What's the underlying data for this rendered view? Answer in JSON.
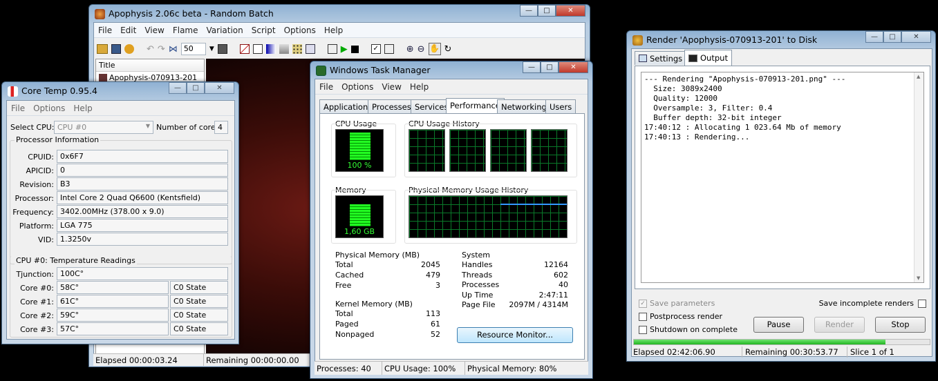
{
  "apophysis": {
    "title": "Apophysis 2.06c beta - Random Batch",
    "menu": [
      "File",
      "Edit",
      "View",
      "Flame",
      "Variation",
      "Script",
      "Options",
      "Help"
    ],
    "zoom_value": "50",
    "list_header": "Title",
    "list_item": "Apophysis-070913-201",
    "status_elapsed": "Elapsed 00:00:03.24",
    "status_remaining": "Remaining 00:00:00.00"
  },
  "coretemp": {
    "title": "Core Temp 0.95.4",
    "menu": [
      "File",
      "Options",
      "Help"
    ],
    "select_cpu_label": "Select CPU:",
    "select_cpu_value": "CPU #0",
    "num_cores_label": "Number of cores",
    "num_cores_value": "4",
    "proc_info_label": "Processor Information",
    "rows": [
      {
        "label": "CPUID:",
        "value": "0x6F7"
      },
      {
        "label": "APICID:",
        "value": "0"
      },
      {
        "label": "Revision:",
        "value": "B3"
      },
      {
        "label": "Processor:",
        "value": "Intel Core 2 Quad Q6600 (Kentsfield)"
      },
      {
        "label": "Frequency:",
        "value": "3402.00MHz (378.00 x 9.0)"
      },
      {
        "label": "Platform:",
        "value": "LGA 775"
      },
      {
        "label": "VID:",
        "value": "1.3250v"
      }
    ],
    "temp_label": "CPU #0: Temperature Readings",
    "tjunction_label": "Tjunction:",
    "tjunction_value": "100C°",
    "cores": [
      {
        "label": "Core #0:",
        "temp": "58C°",
        "state": "C0 State"
      },
      {
        "label": "Core #1:",
        "temp": "61C°",
        "state": "C0 State"
      },
      {
        "label": "Core #2:",
        "temp": "59C°",
        "state": "C0 State"
      },
      {
        "label": "Core #3:",
        "temp": "57C°",
        "state": "C0 State"
      }
    ]
  },
  "taskmgr": {
    "title": "Windows Task Manager",
    "menu": [
      "File",
      "Options",
      "View",
      "Help"
    ],
    "tabs": [
      "Applications",
      "Processes",
      "Services",
      "Performance",
      "Networking",
      "Users"
    ],
    "cpu_usage_label": "CPU Usage",
    "cpu_usage_value": "100 %",
    "cpu_history_label": "CPU Usage History",
    "memory_label": "Memory",
    "memory_value": "1,60 GB",
    "mem_history_label": "Physical Memory Usage History",
    "phys_mem_label": "Physical Memory (MB)",
    "phys_mem": [
      {
        "k": "Total",
        "v": "2045"
      },
      {
        "k": "Cached",
        "v": "479"
      },
      {
        "k": "Free",
        "v": "3"
      }
    ],
    "kernel_label": "Kernel Memory (MB)",
    "kernel": [
      {
        "k": "Total",
        "v": "113"
      },
      {
        "k": "Paged",
        "v": "61"
      },
      {
        "k": "Nonpaged",
        "v": "52"
      }
    ],
    "system_label": "System",
    "system": [
      {
        "k": "Handles",
        "v": "12164"
      },
      {
        "k": "Threads",
        "v": "602"
      },
      {
        "k": "Processes",
        "v": "40"
      },
      {
        "k": "Up Time",
        "v": "2:47:11"
      },
      {
        "k": "Page File",
        "v": "2097M / 4314M"
      }
    ],
    "resource_btn": "Resource Monitor...",
    "status_processes": "Processes: 40",
    "status_cpu": "CPU Usage: 100%",
    "status_mem": "Physical Memory: 80%",
    "cpu_level": 1.0,
    "mem_level": 0.8
  },
  "render": {
    "title": "Render 'Apophysis-070913-201' to Disk",
    "tab_settings": "Settings",
    "tab_output": "Output",
    "log": [
      "--- Rendering \"Apophysis-070913-201.png\" ---",
      "  Size: 3089x2400",
      "  Quality: 12000",
      "  Oversample: 3, Filter: 0.4",
      "  Buffer depth: 32-bit integer",
      "17:40:12 : Allocating 1 023.64 Mb of memory",
      "17:40:13 : Rendering..."
    ],
    "save_params": "Save parameters",
    "postprocess": "Postprocess render",
    "shutdown": "Shutdown on complete",
    "save_incomplete": "Save incomplete renders",
    "pause": "Pause",
    "render": "Render",
    "stop": "Stop",
    "progress": 0.85,
    "status_elapsed": "Elapsed 02:42:06.90",
    "status_remaining": "Remaining 00:30:53.77",
    "status_slice": "Slice 1 of 1"
  }
}
